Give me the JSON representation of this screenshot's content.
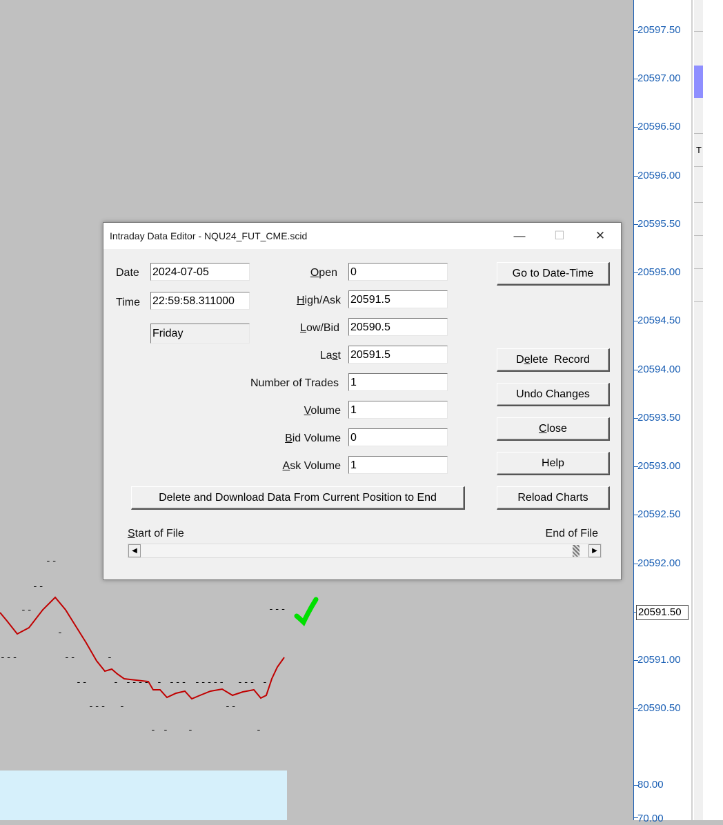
{
  "price_axis": {
    "labels": [
      "20597.50",
      "20597.00",
      "20596.50",
      "20596.00",
      "20595.50",
      "20595.00",
      "20594.50",
      "20594.00",
      "20593.50",
      "20593.00",
      "20592.50",
      "20592.00",
      "20591.50",
      "20591.00",
      "20590.50",
      "80.00",
      "70.00"
    ],
    "current": "20591.50",
    "color": "#1a5fb4"
  },
  "right_strip": {
    "letter": "T"
  },
  "chart": {
    "line_color": "#c00000",
    "checkmark_color": "#00e000"
  },
  "dialog": {
    "title": "Intraday Data Editor - NQU24_FUT_CME.scid",
    "window_controls": {
      "minimize": "—",
      "maximize": "☐",
      "close": "✕"
    },
    "date_label": "Date",
    "date_value": "2024-07-05",
    "time_label": "Time",
    "time_value": "22:59:58.311000",
    "day_value": "Friday",
    "fields": {
      "open": {
        "label_pre": "",
        "label_u": "O",
        "label_post": "pen",
        "value": "0"
      },
      "high": {
        "label_pre": "",
        "label_u": "H",
        "label_post": "igh/Ask",
        "value": "20591.5"
      },
      "low": {
        "label_pre": "",
        "label_u": "L",
        "label_post": "ow/Bid",
        "value": "20590.5"
      },
      "last": {
        "label_pre": "La",
        "label_u": "s",
        "label_post": "t",
        "value": "20591.5"
      },
      "trades": {
        "label": "Number of Trades",
        "value": "1"
      },
      "volume": {
        "label_pre": "",
        "label_u": "V",
        "label_post": "olume",
        "value": "1"
      },
      "bid_volume": {
        "label_pre": "",
        "label_u": "B",
        "label_post": "id Volume",
        "value": "0"
      },
      "ask_volume": {
        "label_pre": "",
        "label_u": "A",
        "label_post": "sk Volume",
        "value": "1"
      }
    },
    "buttons": {
      "go_to": "Go to Date-Time",
      "delete_pre": "D",
      "delete_u": "e",
      "delete_post": "lete  Record",
      "undo": "Undo Changes",
      "close_u": "C",
      "close_post": "lose",
      "help": "Help",
      "reload": "Reload Charts",
      "delete_download": "Delete and Download Data From Current Position to End"
    },
    "start_of_file_u": "S",
    "start_of_file_post": "tart of File",
    "end_of_file": "End of File",
    "scroll_left": "◀",
    "scroll_right": "▶",
    "scroll_position": 0.98
  }
}
